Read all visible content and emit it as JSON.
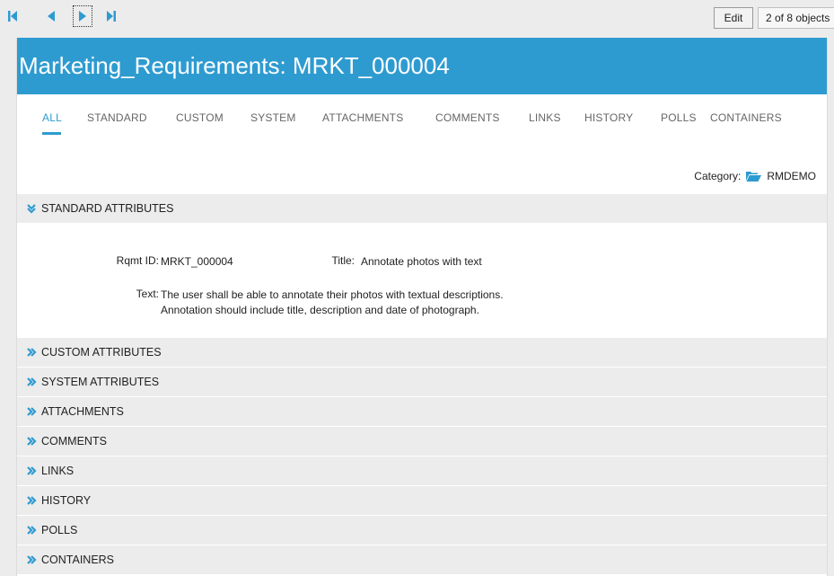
{
  "toolbar": {
    "first_icon": "first-record-icon",
    "prev_icon": "previous-record-icon",
    "next_icon": "next-record-icon",
    "last_icon": "last-record-icon",
    "edit_label": "Edit",
    "counter": "2 of 8 objects",
    "accent": "#2e9bd0"
  },
  "header": {
    "title": "Marketing_Requirements: MRKT_000004",
    "color": "#2e9bd0"
  },
  "tabs": [
    {
      "label": "ALL",
      "active": true
    },
    {
      "label": "STANDARD"
    },
    {
      "label": "CUSTOM"
    },
    {
      "label": "SYSTEM"
    },
    {
      "label": "ATTACHMENTS"
    },
    {
      "label": "COMMENTS"
    },
    {
      "label": "LINKS"
    },
    {
      "label": "HISTORY"
    },
    {
      "label": "POLLS"
    },
    {
      "label": "CONTAINERS"
    }
  ],
  "category": {
    "label": "Category:",
    "icon": "folder-open-icon",
    "value": "RMDEMO"
  },
  "standard": {
    "heading": "STANDARD ATTRIBUTES",
    "expanded": true,
    "rqmt_label": "Rqmt ID:",
    "rqmt_value": "MRKT_000004",
    "title_label": "Title:",
    "title_value": "Annotate photos with text",
    "text_label": "Text:",
    "text_line1": "The user shall be able to annotate their photos with textual descriptions.",
    "text_line2": "Annotation should include title, description and date  of photograph."
  },
  "sections": [
    {
      "label": "CUSTOM ATTRIBUTES"
    },
    {
      "label": "SYSTEM ATTRIBUTES"
    },
    {
      "label": "ATTACHMENTS"
    },
    {
      "label": "COMMENTS"
    },
    {
      "label": "LINKS"
    },
    {
      "label": "HISTORY"
    },
    {
      "label": "POLLS"
    },
    {
      "label": "CONTAINERS"
    }
  ]
}
